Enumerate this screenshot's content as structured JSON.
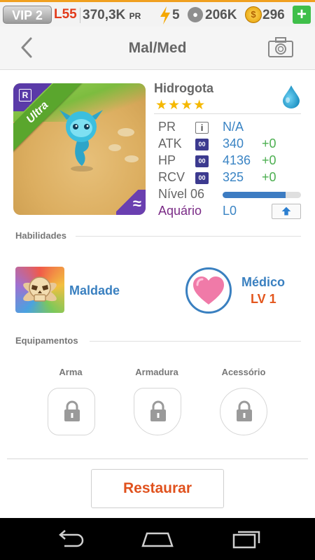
{
  "status_bar": {
    "vip": "VIP 2",
    "level": "L55",
    "power": "370,3K",
    "power_unit": "PR",
    "energy": "5",
    "food": "206K",
    "coins": "296",
    "add_label": "+"
  },
  "header": {
    "title": "Mal/Med"
  },
  "monster": {
    "name": "Hidrogota",
    "rarity": "Ultra",
    "rarity_badge": "R",
    "element_symbol": "≈",
    "stars": 4,
    "star_glyphs": [
      "★",
      "★",
      "★",
      "★"
    ]
  },
  "stats": {
    "pr": {
      "label": "PR",
      "icon": "i",
      "value": "N/A"
    },
    "atk": {
      "label": "ATK",
      "icon": "00",
      "value": "340",
      "bonus": "+0"
    },
    "hp": {
      "label": "HP",
      "icon": "00",
      "value": "4136",
      "bonus": "+0"
    },
    "rcv": {
      "label": "RCV",
      "icon": "00",
      "value": "325",
      "bonus": "+0"
    },
    "level": {
      "label": "Nível 06",
      "progress": 0.8
    },
    "aquario": {
      "label": "Aquário",
      "value": "L0"
    }
  },
  "abilities": {
    "section_title": "Habilidades",
    "skill": {
      "label": "Maldade"
    },
    "leader": {
      "label": "Médico",
      "level": "LV 1"
    }
  },
  "equipment": {
    "section_title": "Equipamentos",
    "slots": [
      {
        "label": "Arma"
      },
      {
        "label": "Armadura"
      },
      {
        "label": "Acessório"
      }
    ]
  },
  "actions": {
    "restore_label": "Restaurar"
  },
  "colors": {
    "accent_blue": "#3a80c0",
    "accent_orange": "#e0521e",
    "bonus_green": "#4caf50",
    "star_gold": "#f5b800"
  }
}
